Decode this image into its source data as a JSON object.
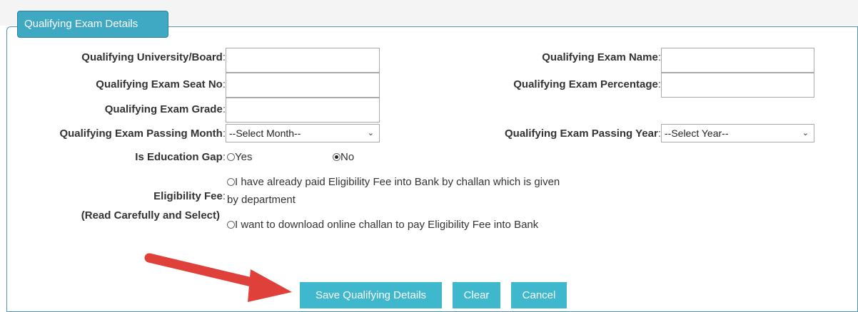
{
  "legend": "Qualifying Exam Details",
  "fields": {
    "university_label": "Qualifying University/Board",
    "exam_name_label": "Qualifying Exam Name",
    "seat_no_label": "Qualifying Exam Seat No",
    "percentage_label": "Qualifying Exam Percentage",
    "grade_label": "Qualifying Exam Grade",
    "passing_month_label": "Qualifying Exam Passing Month",
    "passing_month_value": "--Select Month--",
    "passing_year_label": "Qualifying Exam Passing Year",
    "passing_year_value": "--Select Year--",
    "education_gap_label": "Is Education Gap",
    "gap_yes": "Yes",
    "gap_no": "No",
    "eligibility_label": "Eligibility Fee",
    "eligibility_sub": "(Read Carefully and Select)",
    "eligibility_opt1_line1": "I have already paid Eligibility Fee into Bank by challan which is given",
    "eligibility_opt1_line2": "by department",
    "eligibility_opt2": "I want to download online challan to pay Eligibility Fee into Bank"
  },
  "colon": ":",
  "buttons": {
    "save": "Save Qualifying Details",
    "clear": "Clear",
    "cancel": "Cancel"
  },
  "selection": {
    "education_gap": "No"
  },
  "colors": {
    "accent": "#3fb8ce",
    "arrow": "#e0403a"
  }
}
